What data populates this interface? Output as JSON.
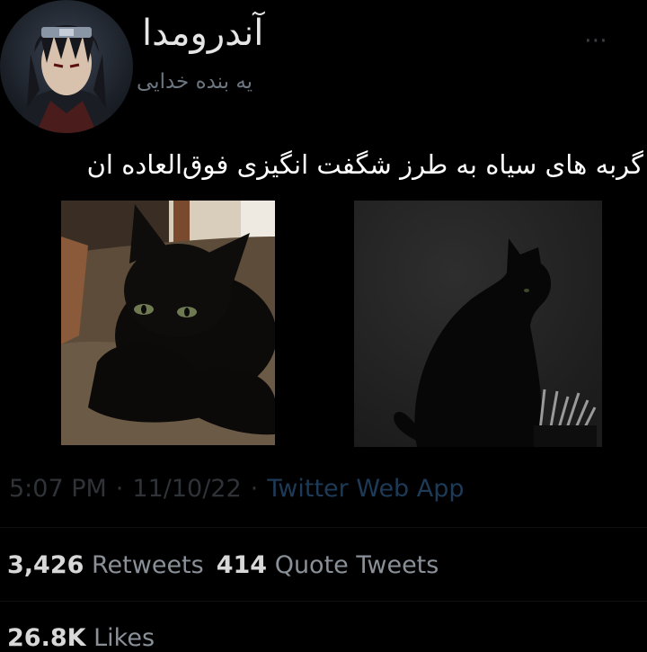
{
  "profile": {
    "display_name": "آندرومدا",
    "handle": "یه بنده خدایی",
    "avatar_icon": "anime-character-avatar"
  },
  "header": {
    "more_icon": "⋯"
  },
  "tweet": {
    "text": "گربه های سیاه به طرز شگفت انگیزی فوق‌العاده ان",
    "media": [
      {
        "icon": "black-kitten-photo"
      },
      {
        "icon": "black-cat-silhouette-photo"
      }
    ],
    "time": "5:07 PM",
    "date": "11/10/22",
    "source": "Twitter Web App",
    "separator": "·"
  },
  "stats": {
    "retweets_count": "3,426",
    "retweets_label": "Retweets",
    "quote_count": "414",
    "quote_label": "Quote Tweets",
    "likes_count": "26.8K",
    "likes_label": "Likes"
  },
  "colors": {
    "background": "#000000",
    "text_primary": "#ffffff",
    "text_muted": "#6b7680",
    "link": "#1d3a57"
  }
}
